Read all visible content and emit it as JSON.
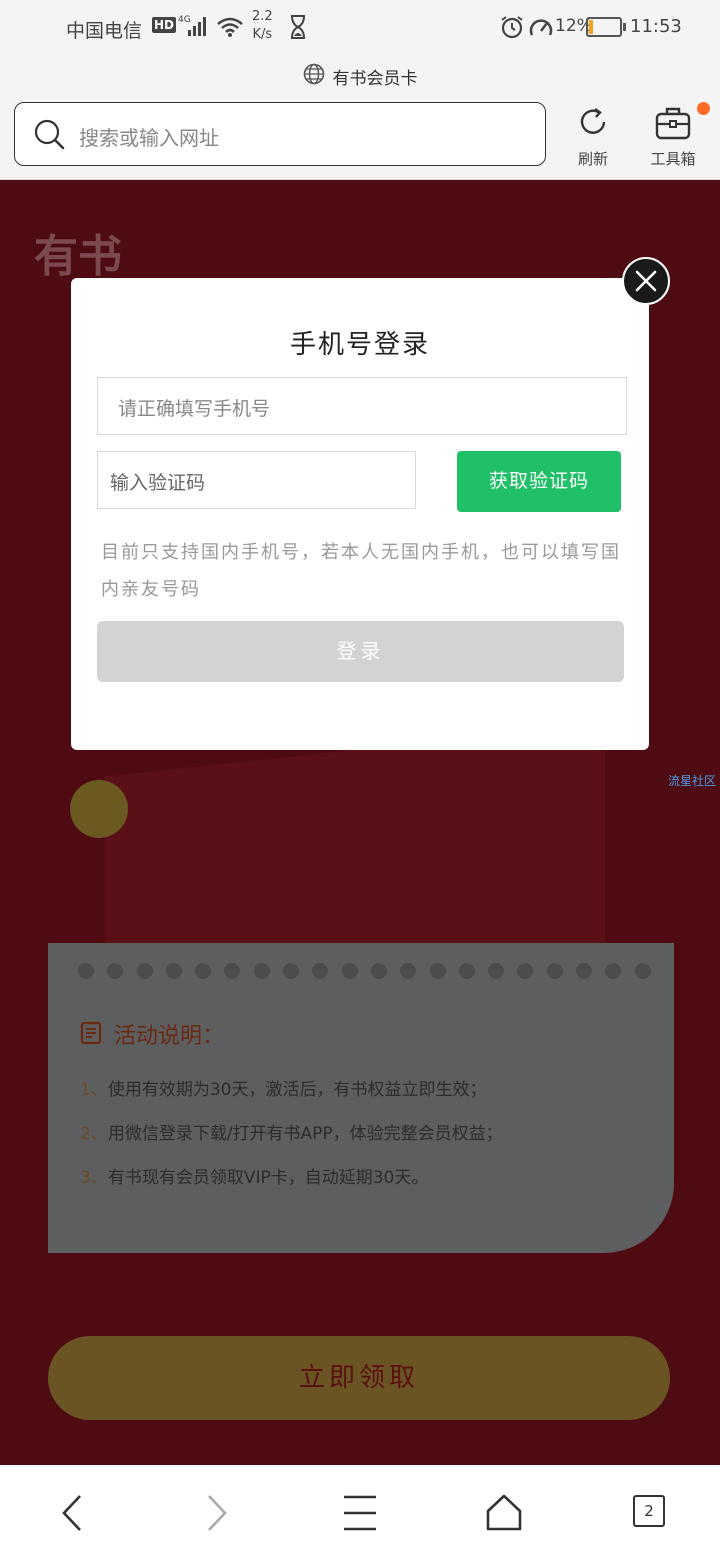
{
  "status_bar": {
    "carrier": "中国电信",
    "hd_badge": "HD",
    "network": "4G",
    "speed_value": "2.2",
    "speed_unit": "K/s",
    "battery_percent": "12%",
    "battery_level": 0.12,
    "time": "11:53"
  },
  "browser": {
    "page_title": "有书会员卡",
    "search_placeholder": "搜索或输入网址",
    "refresh_label": "刷新",
    "toolbox_label": "工具箱",
    "tab_count": "2"
  },
  "background": {
    "logo_text": "有书",
    "side_link": "流星社区",
    "activity_title": "活动说明：",
    "activity_items": [
      "使用有效期为30天，激活后，有书权益立即生效；",
      "用微信登录下载/打开有书APP，体验完整会员权益；",
      "有书现有会员领取VIP卡，自动延期30天。"
    ],
    "activity_numbers": [
      "1、",
      "2、",
      "3、"
    ],
    "claim_button": "立即领取"
  },
  "modal": {
    "title": "手机号登录",
    "phone_placeholder": "请正确填写手机号",
    "code_placeholder": "输入验证码",
    "get_code_button": "获取验证码",
    "note": "目前只支持国内手机号，若本人无国内手机，也可以填写国内亲友号码",
    "login_button": "登录"
  },
  "colors": {
    "accent_green": "#1fc067",
    "notification_dot": "#ff6a2b",
    "battery_fill": "#f2a01c",
    "dim_background": "#4e0c12"
  }
}
